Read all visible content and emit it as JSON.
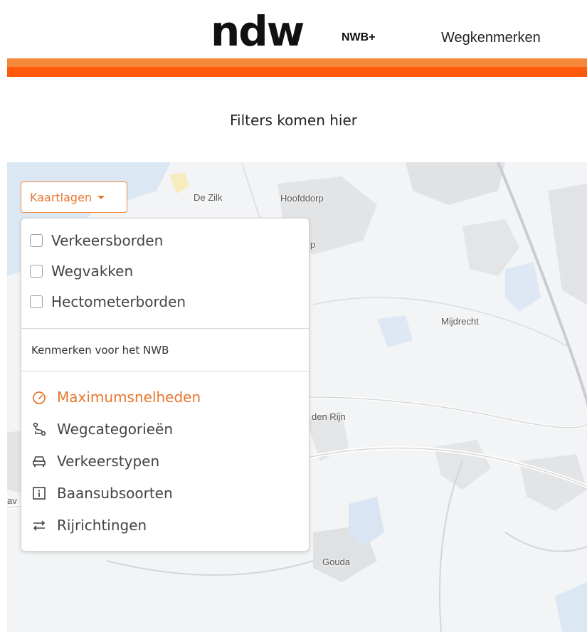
{
  "header": {
    "logo_text": "ndw",
    "logo_sub": "NWB+",
    "nav_link": "Wegkenmerken",
    "colors": {
      "accent_light": "#f6883b",
      "accent": "#ff5a0b"
    }
  },
  "filters_placeholder": "Filters komen hier",
  "map": {
    "labels": [
      "De Zilk",
      "Hoofddorp",
      "Mijdrecht",
      "den Rijn",
      "Gouda",
      "av",
      "p"
    ]
  },
  "layers": {
    "button_label": "Kaartlagen",
    "checkbox_items": [
      {
        "label": "Verkeersborden",
        "checked": false
      },
      {
        "label": "Wegvakken",
        "checked": false
      },
      {
        "label": "Hectometerborden",
        "checked": false
      }
    ],
    "section_label": "Kenmerken voor het NWB",
    "kenmerken": [
      {
        "label": "Maximumsnelheden",
        "icon": "speedometer-icon",
        "active": true
      },
      {
        "label": "Wegcategorieën",
        "icon": "route-icon",
        "active": false
      },
      {
        "label": "Verkeerstypen",
        "icon": "car-icon",
        "active": false
      },
      {
        "label": "Baansubsoorten",
        "icon": "info-square-icon",
        "active": false
      },
      {
        "label": "Rijrichtingen",
        "icon": "arrows-left-right-icon",
        "active": false
      }
    ]
  }
}
